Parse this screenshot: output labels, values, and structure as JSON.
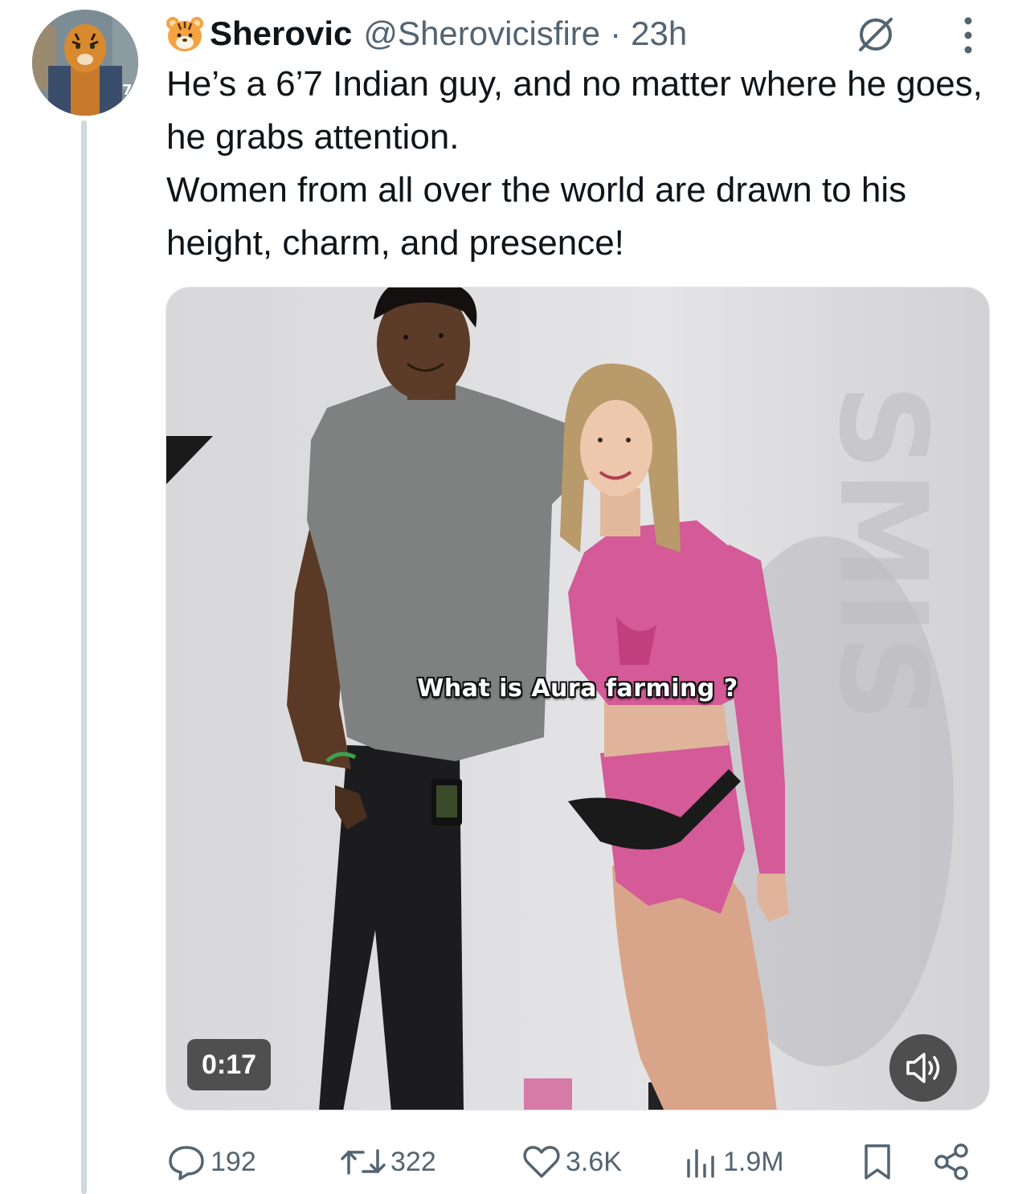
{
  "author": {
    "display_name": "Sherovic",
    "handle": "@Sherovicisfire",
    "separator": "·",
    "time": "23h",
    "name_emoji": "tiger-face-emoji"
  },
  "tweet": {
    "lines": [
      "He’s a 6’7 Indian guy, and no matter where he goes, he grabs attention.",
      "Women from all over the world are drawn to his height, charm, and presence!"
    ]
  },
  "video": {
    "caption": "What is Aura farming ?",
    "duration": "0:17"
  },
  "stats": {
    "replies": "192",
    "reposts": "322",
    "likes": "3.6K",
    "views": "1.9M"
  },
  "icons": {
    "header": [
      "grok-icon",
      "more-options-icon"
    ],
    "media": [
      "volume-icon"
    ],
    "actions": [
      "reply-icon",
      "repost-icon",
      "like-icon",
      "views-icon",
      "bookmark-icon",
      "share-icon"
    ]
  },
  "colors": {
    "text": "#0f1419",
    "secondary": "#536471",
    "thread_line": "#cfd9de",
    "shirt_pink": "#d45a98"
  }
}
